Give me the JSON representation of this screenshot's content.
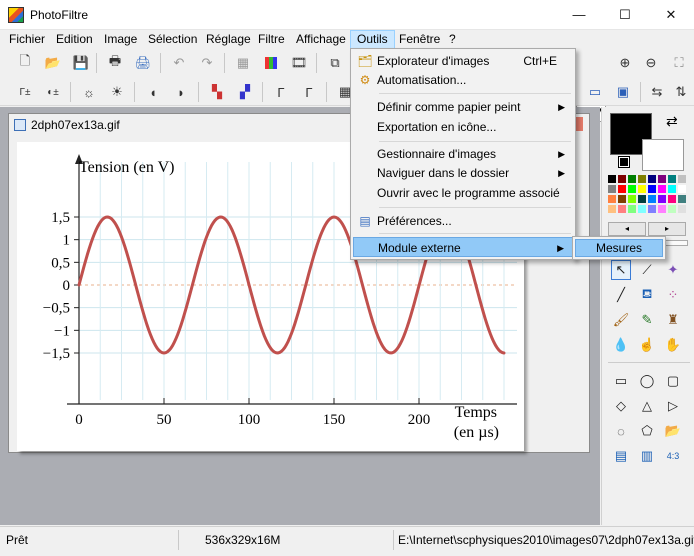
{
  "window": {
    "title": "PhotoFiltre",
    "minimize": "—",
    "maximize": "☐",
    "close": "✕"
  },
  "menubar": [
    "Fichier",
    "Edition",
    "Image",
    "Sélection",
    "Réglage",
    "Filtre",
    "Affichage",
    "Outils",
    "Fenêtre",
    "?"
  ],
  "document": {
    "title": "2dph07ex13a.gif"
  },
  "graph": {
    "ylabel": "Tension (en V)",
    "xlabel_1": "Temps",
    "xlabel_2": "(en µs)",
    "yticks": [
      "1,5",
      "1",
      "0,5",
      "0",
      "−0,5",
      "−1",
      "−1,5"
    ],
    "xticks": [
      "0",
      "50",
      "100",
      "150",
      "200"
    ],
    "series_color": "#c0504d"
  },
  "chart_data": {
    "type": "line",
    "xlabel": "Temps (en µs)",
    "ylabel": "Tension (en V)",
    "xlim": [
      0,
      250
    ],
    "ylim": [
      -1.5,
      1.5
    ],
    "amplitude": 1.5,
    "period": 66.7,
    "x": [
      0,
      16.7,
      33.3,
      50,
      66.7,
      83.3,
      100,
      116.7,
      133.3,
      150,
      166.7,
      183.3,
      200,
      216.7,
      233.3,
      250
    ],
    "y": [
      0,
      1.5,
      0,
      -1.5,
      0,
      1.5,
      0,
      -1.5,
      0,
      1.5,
      0,
      -1.5,
      0,
      1.5,
      0,
      -1.5
    ]
  },
  "outils_menu": {
    "items": [
      {
        "label": "Explorateur d'images",
        "shortcut": "Ctrl+E",
        "icon": "explorer-icon"
      },
      {
        "label": "Automatisation...",
        "icon": "gears-icon"
      },
      {
        "label": "Définir comme papier peint",
        "submenu": true
      },
      {
        "label": "Exportation en icône..."
      },
      {
        "label": "Gestionnaire d'images",
        "submenu": true
      },
      {
        "label": "Naviguer dans le dossier",
        "submenu": true
      },
      {
        "label": "Ouvrir avec le programme associé"
      },
      {
        "label": "Préférences...",
        "icon": "preferences-icon"
      },
      {
        "label": "Module externe",
        "submenu": true
      }
    ],
    "submenu_label": "Mesures"
  },
  "colors": {
    "primary": "#000000",
    "secondary": "#ffffff",
    "palette": [
      "#000000",
      "#7f0000",
      "#007f00",
      "#7f7f00",
      "#00007f",
      "#7f007f",
      "#007f7f",
      "#c0c0c0",
      "#808080",
      "#ff0000",
      "#00ff00",
      "#ffff00",
      "#0000ff",
      "#ff00ff",
      "#00ffff",
      "#ffffff",
      "#ff8040",
      "#804000",
      "#80ff00",
      "#004040",
      "#0080ff",
      "#8000ff",
      "#ff0080",
      "#408080",
      "#ffc080",
      "#ff8080",
      "#80ff80",
      "#80ffff",
      "#8080ff",
      "#ff80ff",
      "#c0ffc0",
      "#e0e0e0"
    ]
  },
  "status": {
    "state": "Prêt",
    "size": "536x329x16M",
    "path": "E:\\Internet\\scphysiques2010\\images07\\2dph07ex13a.gif"
  }
}
